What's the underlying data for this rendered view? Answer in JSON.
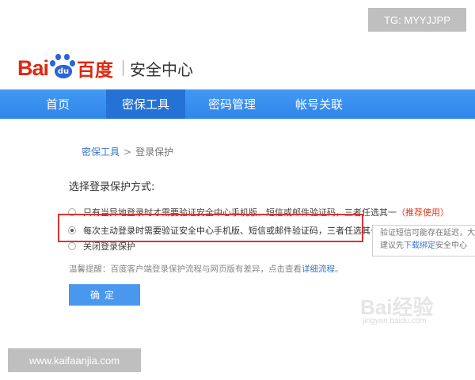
{
  "watermarks": {
    "telegram": "TG: MYYJJPP",
    "site": "www.kaifaanjia.com",
    "baidu_jingyan": "Bai经验",
    "baidu_jingyan_url": "jingyan.baidu.com"
  },
  "logo": {
    "bai": "Bai",
    "du": "du",
    "cn": "百度",
    "title": "安全中心"
  },
  "nav": {
    "items": [
      {
        "label": "首页"
      },
      {
        "label": "密保工具"
      },
      {
        "label": "密码管理"
      },
      {
        "label": "帐号关联"
      }
    ],
    "active_index": 1
  },
  "breadcrumb": {
    "parent": "密保工具",
    "separator": ">",
    "current": "登录保护"
  },
  "section_title": "选择登录保护方式:",
  "options": [
    {
      "text": "只有当异地登录时才需要验证安全中心手机版、短信或邮件验证码，三者任选其一",
      "suffix": "（推荐使用）",
      "checked": false
    },
    {
      "text": "每次主动登录时需要验证安全中心手机版、短信或邮件验证码，三者任选其一",
      "checked": true
    },
    {
      "text": "关闭登录保护",
      "checked": false
    }
  ],
  "tip": {
    "line1": "验证短信可能存在延迟，大",
    "line2_prefix": "建议先",
    "line2_link": "下载绑定",
    "line2_suffix": "安全中心"
  },
  "warm_tip": {
    "text": "温馨提醒：百度客户端登录保护流程与网页版有差异，点击查看",
    "link": "详细流程",
    "end": "。"
  },
  "confirm_label": "确定",
  "colors": {
    "brand_red": "#de2910",
    "brand_blue": "#2b63d9",
    "nav_blue": "#3a8ff0",
    "highlight_red": "#d9332e",
    "link_blue": "#3a76c9"
  }
}
